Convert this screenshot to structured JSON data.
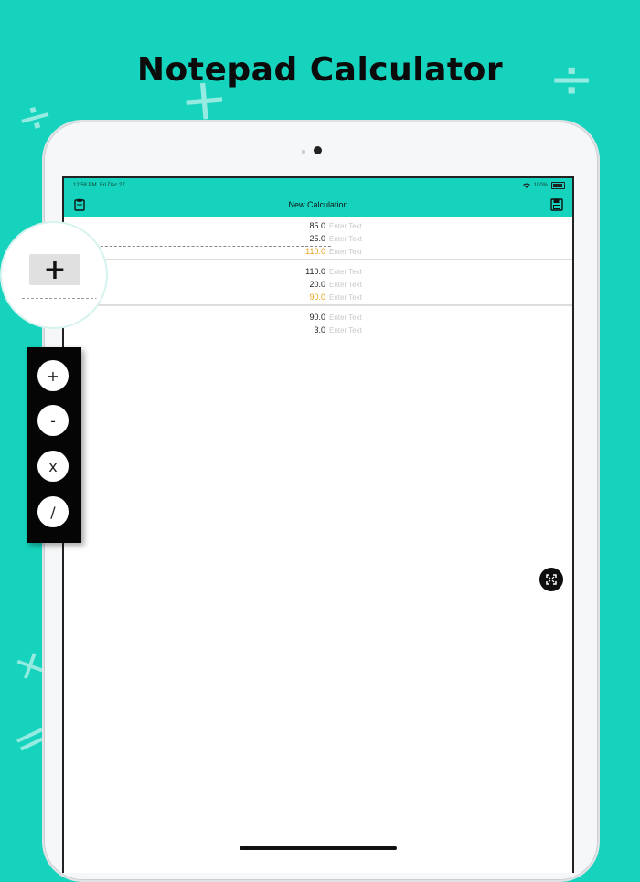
{
  "headline": "Notepad Calculator",
  "status_bar": {
    "time": "12:58 PM",
    "date": "Fri Dec 27",
    "battery": "100%"
  },
  "nav": {
    "title": "New Calculation",
    "left_icon": "clipboard-icon",
    "right_icon": "save-icon"
  },
  "rows": [
    {
      "value": "85.0",
      "placeholder": "Enter Text",
      "sum": false
    },
    {
      "value": "25.0",
      "placeholder": "Enter Text",
      "sum": false
    },
    {
      "value": "110.0",
      "placeholder": "Enter Text",
      "sum": true
    },
    {
      "value": "110.0",
      "placeholder": "Enter Text",
      "sum": false
    },
    {
      "value": "20.0",
      "placeholder": "Enter Text",
      "sum": false
    },
    {
      "value": "90.0",
      "placeholder": "Enter Text",
      "sum": true
    },
    {
      "value": "90.0",
      "placeholder": "Enter Text",
      "sum": false
    },
    {
      "value": "3.0",
      "placeholder": "Enter Text",
      "sum": false
    }
  ],
  "magnifier_key": "+",
  "operators": [
    "+",
    "-",
    "x",
    "/"
  ],
  "colors": {
    "accent": "#16d3bd",
    "sum": "#e8a21a"
  }
}
